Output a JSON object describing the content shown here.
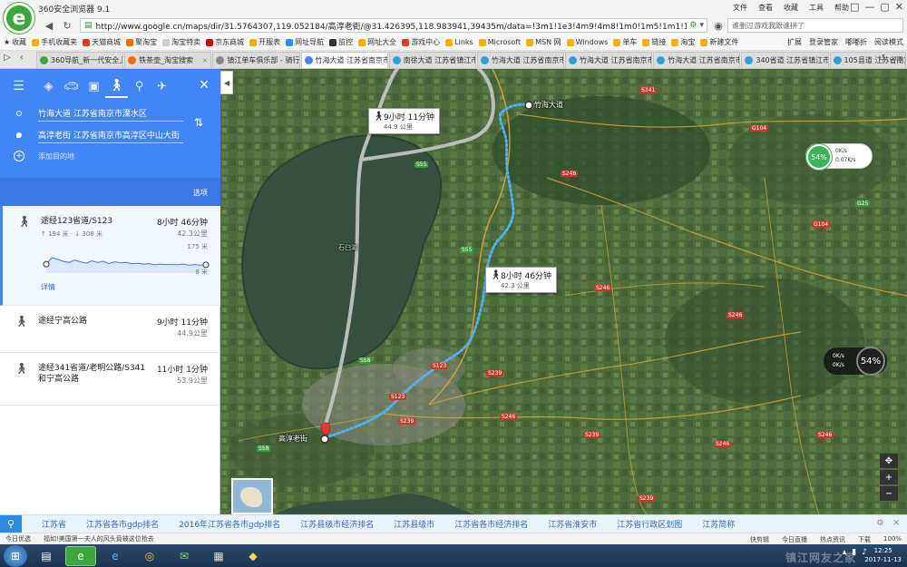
{
  "browser": {
    "app_title": "360安全浏览器 9.1",
    "logo_letter": "e",
    "menu": [
      "文件",
      "查看",
      "收藏",
      "工具",
      "帮助"
    ],
    "window_controls": [
      "□",
      "—",
      "▢",
      "✕"
    ],
    "address_url": "http://www.google.cn/maps/dir/31.5764307,119.052184/高淳老街/@31.426395,118.983941,39435m/data=!3m1!1e3!4m9!4m8!1m0!1m5!1m1!1s0x3",
    "search_placeholder": "谁删过游戏我跟谁拼了",
    "bookmarks": [
      "收藏",
      "手机收藏夹",
      "天猫商城",
      "聚淘宝",
      "淘宝特卖",
      "京东商城",
      "开服表",
      "网址导航",
      "监控",
      "网址大全",
      "游戏中心",
      "Links",
      "Microsoft",
      "MSN 网",
      "Windows",
      "单车",
      "链接",
      "淘宝",
      "新建文件"
    ],
    "bookmarks_right": [
      "扩展",
      "登录管家",
      "嘟嘟折",
      "阅读模式"
    ],
    "tabs": [
      {
        "title": "360导航_新一代安全上网",
        "active": false
      },
      {
        "title": "铁茶壶_淘宝搜索",
        "active": false
      },
      {
        "title": "镇江单车俱乐部 - 骑行",
        "active": false
      },
      {
        "title": "竹海大道 江苏省南京市",
        "active": true
      },
      {
        "title": "南徐大道 江苏省镇江市",
        "active": false
      },
      {
        "title": "竹海大道 江苏省南京市",
        "active": false
      },
      {
        "title": "竹海大道 江苏省南京市",
        "active": false
      },
      {
        "title": "竹海大道 江苏省南京市",
        "active": false
      },
      {
        "title": "340省道 江苏省镇江市",
        "active": false
      },
      {
        "title": "105县道 江苏省南京市",
        "active": false
      }
    ]
  },
  "panel": {
    "origin": "竹海大道 江苏省南京市溧水区",
    "destination": "高淳老街 江苏省南京市高淳区中山大街",
    "add_destination": "添加目的地",
    "options": "选项",
    "routes": [
      {
        "via": "途经123省道/S123",
        "time": "8小时 46分钟",
        "distance": "42.3公里",
        "elevation": "↑ 194 米 · ↓ 308 米",
        "elev_max": "175 米",
        "elev_min": "8 米",
        "details": "详情"
      },
      {
        "via": "途经宁高公路",
        "time": "9小时 11分钟",
        "distance": "44.9公里"
      },
      {
        "via": "途经341省道/老明公路/S341和宁高公路",
        "time": "11小时 1分钟",
        "distance": "53.9公里"
      }
    ],
    "elevation_profile": [
      0.62,
      0.35,
      0.42,
      0.5,
      0.55,
      0.45,
      0.52,
      0.58,
      0.48,
      0.55,
      0.5,
      0.6,
      0.52,
      0.57,
      0.55,
      0.6,
      0.58,
      0.62,
      0.6,
      0.65,
      0.62,
      0.64,
      0.63,
      0.65,
      0.62,
      0.66,
      0.64,
      0.66,
      0.65
    ]
  },
  "map": {
    "start_label": "竹海大道",
    "end_label": "高淳老街",
    "lake_label": "石臼湖",
    "callout_primary": {
      "time": "8小时 46分钟",
      "dist": "42.3 公里"
    },
    "callout_alt": {
      "time": "9小时 11分钟",
      "dist": "44.9 公里"
    },
    "shields": [
      "S341",
      "S55",
      "G104",
      "S246",
      "S55",
      "S246",
      "S123",
      "S239",
      "S123",
      "S239",
      "S239",
      "S58",
      "S58",
      "S246",
      "S246",
      "S246",
      "S246",
      "G104",
      "G25",
      "S239"
    ],
    "speed_widget": {
      "pct": "54%",
      "up": "0K/s",
      "down": "0.07K/s"
    },
    "pct_widget": {
      "pct": "54%",
      "up": "0K/s",
      "down": "0K/s"
    },
    "colors": {
      "route": "#4fb1f5",
      "alt_route": "#c8c8c8",
      "water": "#36503f",
      "land": "#4e6b3c"
    }
  },
  "related": {
    "items": [
      "江苏省",
      "江苏省各市gdp排名",
      "2016年江苏省各市gdp排名",
      "江苏县级市经济排名",
      "江苏县级市",
      "江苏省各市经济排名",
      "江苏省淮安市",
      "江苏省行政区划图",
      "江苏简称"
    ],
    "ctrls": [
      "⚙",
      "✕"
    ]
  },
  "status": {
    "left": [
      "今日优选",
      "福如!美国第一夫人的风头竟被这位抢去"
    ],
    "right": [
      "快剪辑",
      "今日直播",
      "热点资讯",
      "下载",
      "100%"
    ]
  },
  "taskbar": {
    "time": "12:25",
    "date": "2017-11-13",
    "watermark": "镇江网友之家"
  }
}
